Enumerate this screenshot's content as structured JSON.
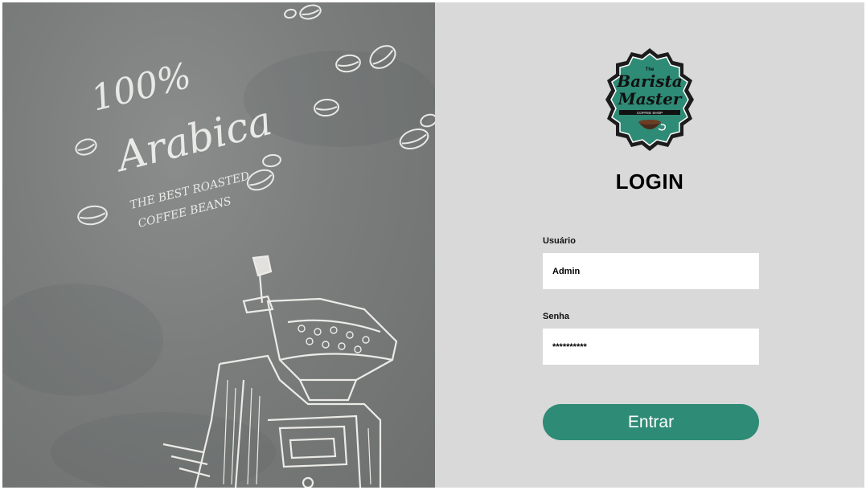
{
  "hero": {
    "line1": "100%",
    "line2": "Arabica",
    "line3": "THE BEST ROASTED",
    "line4": "COFFEE BEANS"
  },
  "logo": {
    "the": "The",
    "barista": "Barista",
    "master": "Master",
    "shop": "COFFEE SHOP"
  },
  "login": {
    "title": "LOGIN",
    "username_label": "Usuário",
    "username_value": "Admin",
    "password_label": "Senha",
    "password_value": "**********",
    "submit_label": "Entrar"
  },
  "colors": {
    "accent": "#2e8b76",
    "panel": "#d9d9d9",
    "concrete": "#7a7d7c"
  }
}
